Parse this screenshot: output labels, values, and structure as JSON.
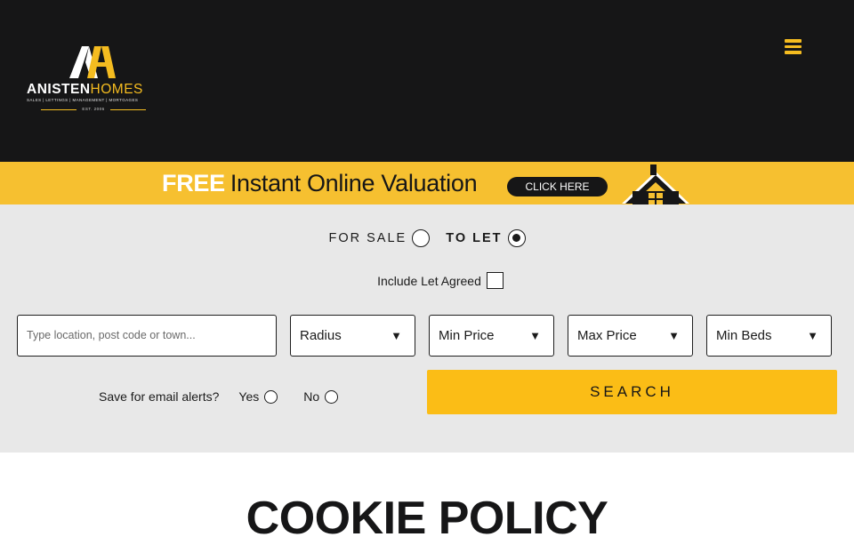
{
  "brand": {
    "name_main": "ANISTEN",
    "name_accent": "HOMES",
    "tagline": "SALES | LETTINGS | MANAGEMENT | MORTGAGES",
    "established": "EST. 2006",
    "accent_color": "#f5bc20"
  },
  "header": {
    "menu_icon": "hamburger-icon"
  },
  "banner": {
    "free": "FREE",
    "text": "Instant Online Valuation",
    "button": "CLICK HERE",
    "icon": "house-icon"
  },
  "search": {
    "for_sale": "FOR SALE",
    "to_let": "TO LET",
    "selected_type": "to_let",
    "include_let_agreed": "Include Let Agreed",
    "location_placeholder": "Type location, post code or town...",
    "radius": "Radius",
    "min_price": "Min Price",
    "max_price": "Max Price",
    "min_beds": "Min Beds",
    "alerts_label": "Save for email alerts?",
    "yes": "Yes",
    "no": "No",
    "search_button": "SEARCH",
    "caret": "▼"
  },
  "page": {
    "title": "COOKIE POLICY"
  }
}
